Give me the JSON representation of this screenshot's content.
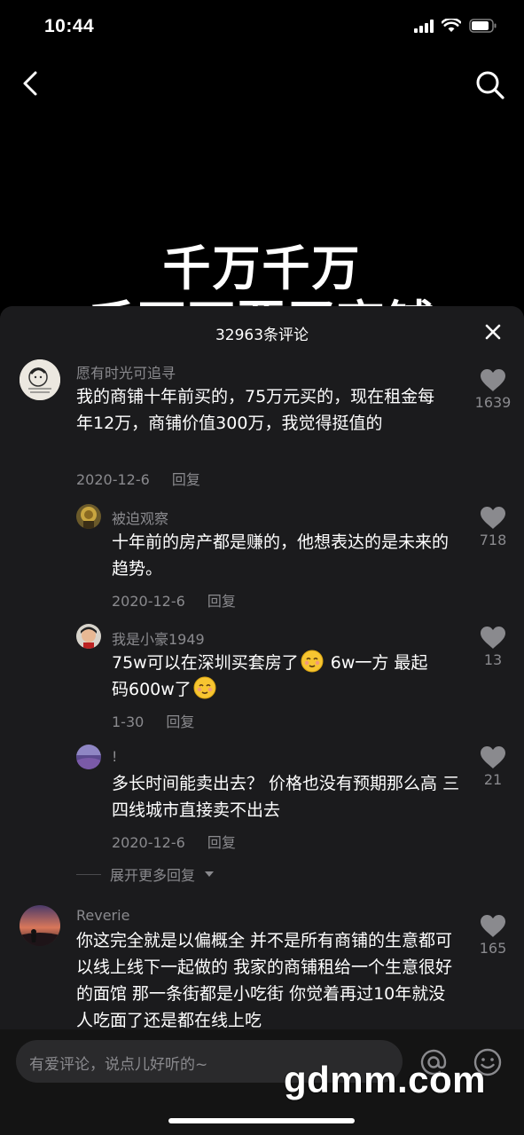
{
  "status": {
    "time": "10:44"
  },
  "video": {
    "title_line1": "千万千万",
    "title_line2": "千万不要买商铺"
  },
  "comments_panel": {
    "count_label": "32963条评论",
    "expand_more": "展开更多回复",
    "comments": [
      {
        "user": "愿有时光可追寻",
        "text": "我的商铺十年前买的，75万元买的，现在租金每年12万，商铺价值300万，我觉得挺值的",
        "date": "2020-12-6",
        "reply": "回复",
        "likes": "1639"
      },
      {
        "user": "被迫观察",
        "text": "十年前的房产都是赚的，他想表达的是未来的趋势。",
        "date": "2020-12-6",
        "reply": "回复",
        "likes": "718"
      },
      {
        "user": "我是小豪1949",
        "text_a": "75w可以在深圳买套房了",
        "text_b": " 6w一方 最起",
        "text_c": "码600w了",
        "date": "1-30",
        "reply": "回复",
        "likes": "13"
      },
      {
        "user": "!",
        "text": "多长时间能卖出去？ 价格也没有预期那么高 三四线城市直接卖不出去",
        "date": "2020-12-6",
        "reply": "回复",
        "likes": "21"
      },
      {
        "user": "Reverie",
        "text": "你这完全就是以偏概全 并不是所有商铺的生意都可以线上线下一起做的 我家的商铺租给一个生意很好的面馆 那一条街都是小吃街 你觉着再过10年就没人吃面了还是都在线上吃",
        "likes": "165"
      }
    ]
  },
  "input": {
    "placeholder": "有爱评论，说点儿好听的~"
  },
  "watermark": "gdmm.com",
  "icons": [
    "back-icon",
    "search-icon",
    "close-icon",
    "heart-icon",
    "at-icon",
    "emoji-icon",
    "chevron-down-icon"
  ]
}
